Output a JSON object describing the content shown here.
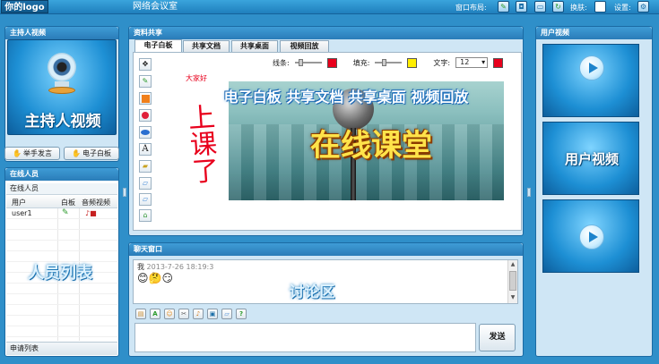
{
  "header": {
    "logo_text": "你的logo",
    "app_title": "网络会议室",
    "layout_label": "窗口布局:",
    "switch_label": "换肤:",
    "settings_label": "设置:"
  },
  "host": {
    "title": "主持人视频",
    "video_caption": "主持人视频",
    "raise_hand_button": "举手发言",
    "whiteboard_button": "电子白板"
  },
  "online": {
    "title": "在线人员",
    "subtitle": "在线人员",
    "columns": [
      "用户",
      "白板",
      "音频视频"
    ],
    "rows": [
      {
        "user": "user1"
      }
    ],
    "overlay_caption": "人员列表",
    "footer_label": "申请列表"
  },
  "share": {
    "title": "资料共享",
    "tabs": [
      "电子白板",
      "共享文档",
      "共享桌面",
      "视频回放"
    ],
    "line_label": "线条:",
    "fill_label": "填充:",
    "text_label": "文字:",
    "font_size": "12",
    "line_color": "#e8001c",
    "fill_color": "#ffee00",
    "text_color": "#e8001c",
    "small_red_text": "大家好",
    "handwriting_text": "上课了",
    "banner_features": "电子白板 共享文档 共享桌面 视频回放",
    "banner_title": "在线课堂",
    "tools": [
      "move-icon",
      "pencil-icon",
      "rectangle-icon",
      "circle-icon",
      "ellipse-icon",
      "text-icon",
      "highlighter-icon",
      "eraser-icon",
      "clear-eraser-icon",
      "trash-icon"
    ]
  },
  "chat": {
    "title": "聊天窗口",
    "msg_sender": "我",
    "msg_time": "2013-7-26 18:19:3",
    "emojis": [
      "😊",
      "🤔",
      "😏"
    ],
    "overlay_caption": "讨论区",
    "toolbar_icons": [
      "font-icon",
      "text-color-icon",
      "emoji-icon",
      "screenshot-icon",
      "sound-icon",
      "save-icon",
      "clear-icon",
      "help-icon"
    ],
    "send_button": "发送"
  },
  "user_video": {
    "title": "用户视频",
    "tile_caption": "用户视频"
  },
  "colors": {
    "background": "#2f8fc9",
    "panel": "#cfe6f5",
    "header": "#2a7cb8"
  }
}
